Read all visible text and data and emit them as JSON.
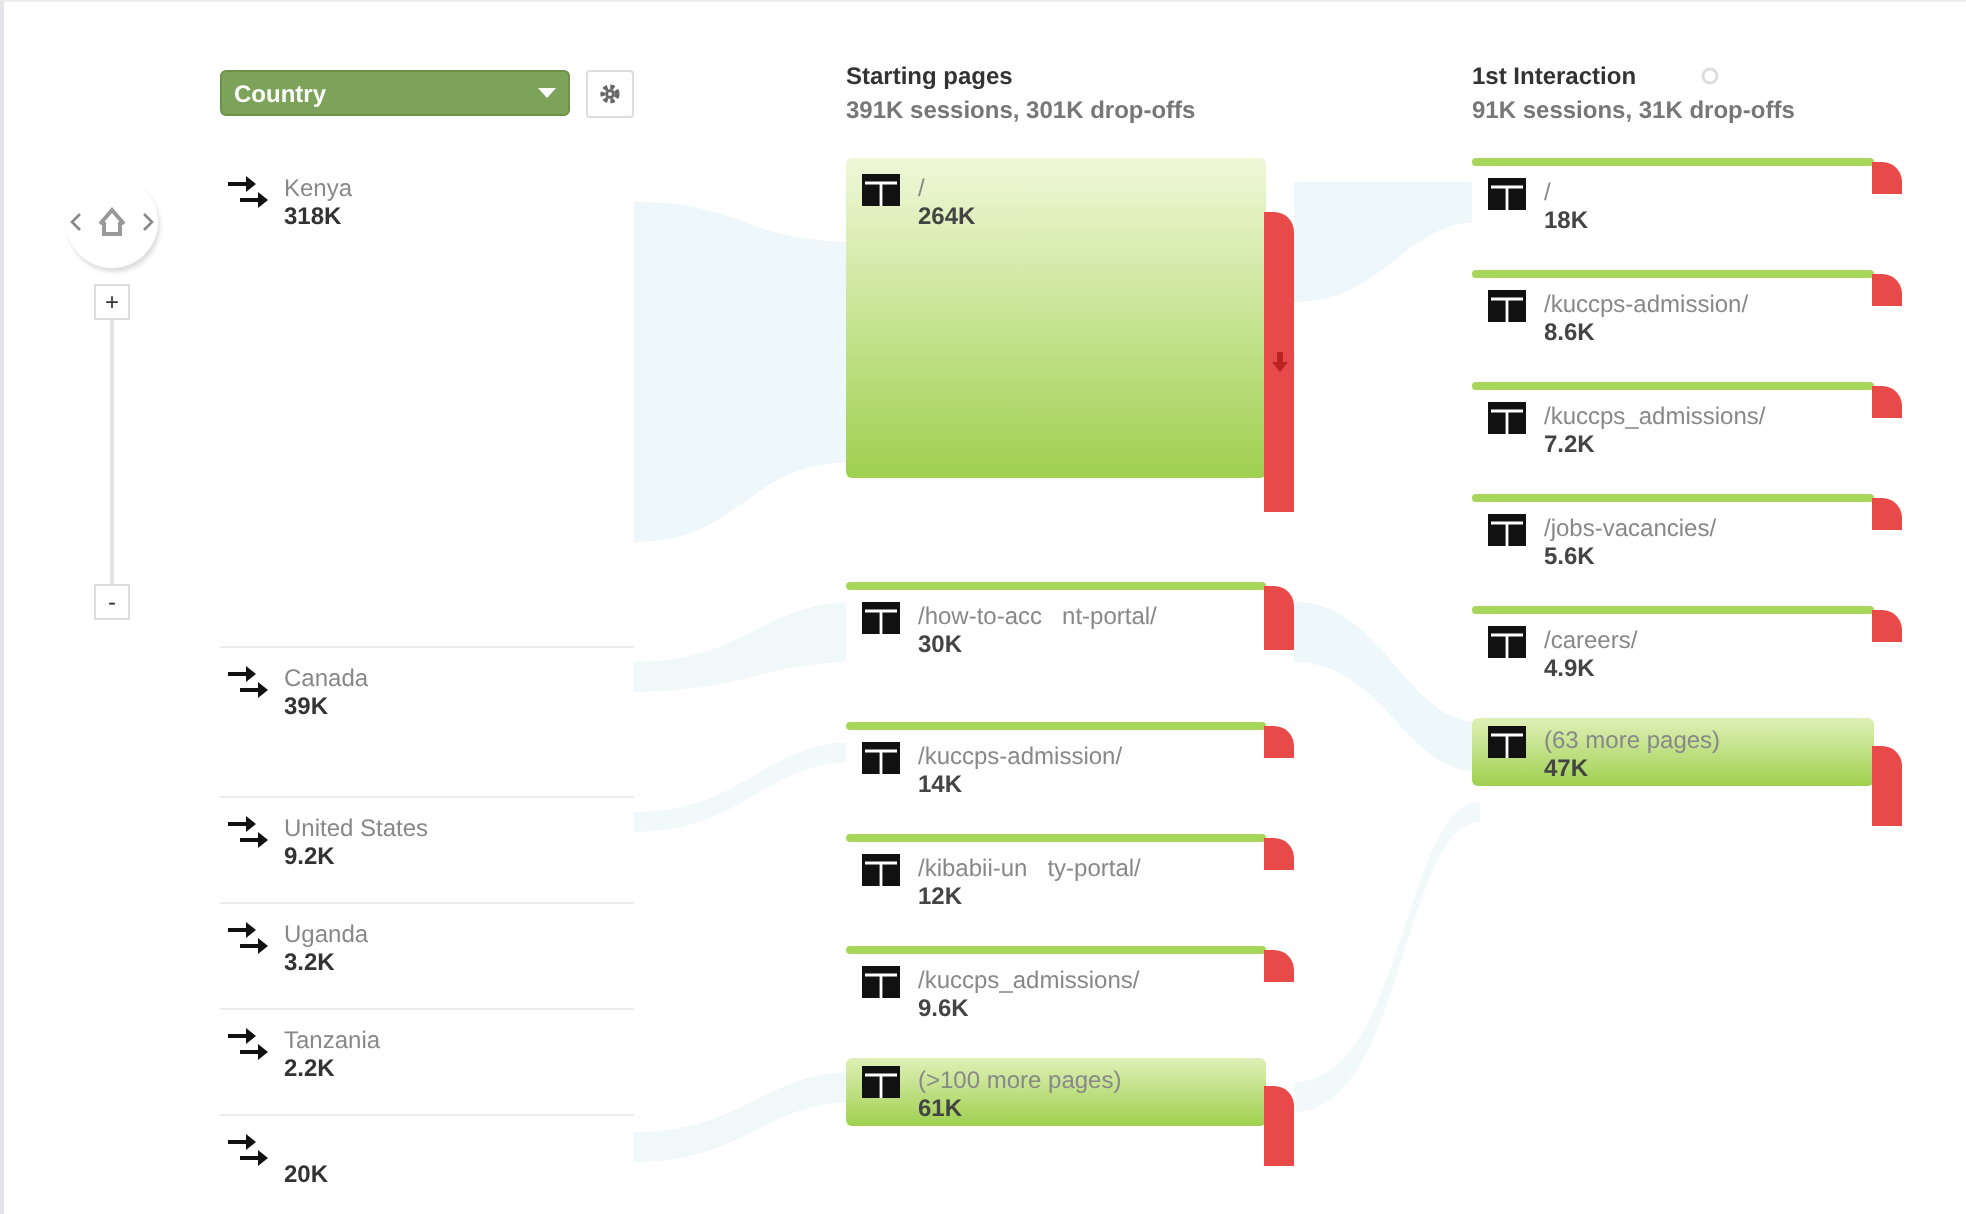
{
  "controls": {
    "zoom_in": "+",
    "zoom_out": "-"
  },
  "dimension": {
    "label": "Country"
  },
  "countries": [
    {
      "name": "Kenya",
      "value": "318K",
      "kind": "large"
    },
    {
      "name": "Canada",
      "value": "39K",
      "kind": "medium"
    },
    {
      "name": "United States",
      "value": "9.2K",
      "kind": "small"
    },
    {
      "name": "Uganda",
      "value": "3.2K",
      "kind": "small"
    },
    {
      "name": "Tanzania",
      "value": "2.2K",
      "kind": "small"
    },
    {
      "value": "20K",
      "kind": "small"
    }
  ],
  "columns": [
    {
      "title": "Starting pages",
      "summary": "391K sessions, 301K drop-offs",
      "loading": false,
      "nodes": [
        {
          "page": "/",
          "value": "264K",
          "kind": "large"
        },
        {
          "page": "/how-to-acc   nt-portal/",
          "value": "30K",
          "kind": "medium"
        },
        {
          "page": "/kuccps-admission/",
          "value": "14K",
          "kind": "small"
        },
        {
          "page": "/kibabii-un   ty-portal/",
          "value": "12K",
          "kind": "small"
        },
        {
          "page": "/kuccps_admissions/",
          "value": "9.6K",
          "kind": "small"
        },
        {
          "page": "(>100 more pages)",
          "value": "61K",
          "kind": "more"
        }
      ]
    },
    {
      "title": "1st Interaction",
      "summary": "91K sessions, 31K drop-offs",
      "loading": true,
      "nodes": [
        {
          "page": "/",
          "value": "18K",
          "kind": "small"
        },
        {
          "page": "/kuccps-admission/",
          "value": "8.6K",
          "kind": "small"
        },
        {
          "page": "/kuccps_admissions/",
          "value": "7.2K",
          "kind": "small"
        },
        {
          "page": "/jobs-vacancies/",
          "value": "5.6K",
          "kind": "small"
        },
        {
          "page": "/careers/",
          "value": "4.9K",
          "kind": "small"
        },
        {
          "page": "(63 more pages)",
          "value": "47K",
          "kind": "more"
        }
      ]
    }
  ]
}
